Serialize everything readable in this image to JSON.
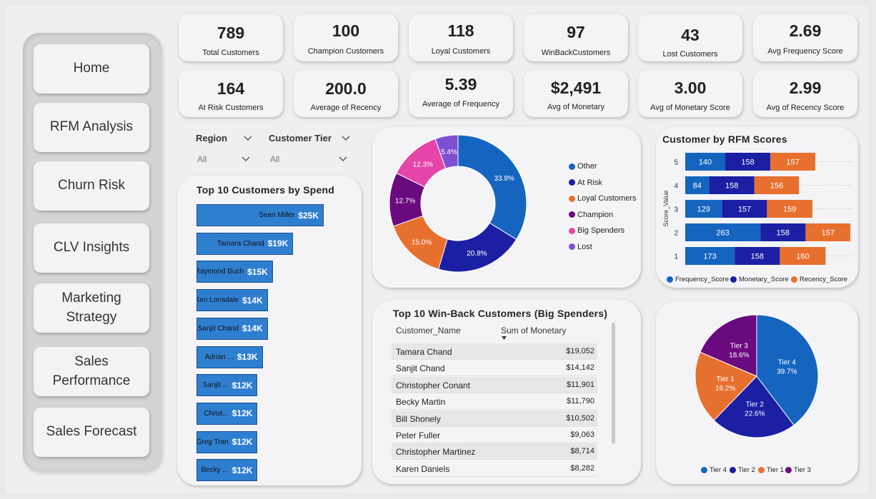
{
  "nav": {
    "home": "Home",
    "rfm": "RFM Analysis",
    "churn": "Churn Risk",
    "clv": "CLV Insights",
    "marketing_1": "Marketing",
    "marketing_2": "Strategy",
    "sales_perf_1": "Sales",
    "sales_perf_2": "Performance",
    "forecast": "Sales Forecast"
  },
  "kpis": [
    {
      "value": "789",
      "label": "Total Customers"
    },
    {
      "value": "100",
      "label": "Champion Customers"
    },
    {
      "value": "118",
      "label": "Loyal Customers"
    },
    {
      "value": "97",
      "label": "WinBackCustomers"
    },
    {
      "value": "43",
      "label": "Lost Customers"
    },
    {
      "value": "2.69",
      "label": "Avg Frequency Score"
    },
    {
      "value": "164",
      "label": "At Risk Customers"
    },
    {
      "value": "200.0",
      "label": "Average of Recency"
    },
    {
      "value": "5.39",
      "label": "Average of Frequency"
    },
    {
      "value": "$2,491",
      "label": "Avg of Monetary"
    },
    {
      "value": "3.00",
      "label": "Avg of Monetary Score"
    },
    {
      "value": "2.99",
      "label": "Avg of Recency Score"
    }
  ],
  "slicers": {
    "region_label": "Region",
    "region_value": "All",
    "tier_label": "Customer Tier",
    "tier_value": "All"
  },
  "top_spend": {
    "title": "Top 10 Customers by Spend",
    "rows": [
      {
        "name": "Sean Miller",
        "value": 25,
        "label": "$25K"
      },
      {
        "name": "Tamara Chand",
        "value": 19,
        "label": "$19K"
      },
      {
        "name": "Raymond Buch",
        "value": 15,
        "label": "$15K"
      },
      {
        "name": "Ken Lonsdale",
        "value": 14,
        "label": "$14K"
      },
      {
        "name": "Sanjit Chand",
        "value": 14,
        "label": "$14K"
      },
      {
        "name": "Adrian ...",
        "value": 13,
        "label": "$13K"
      },
      {
        "name": "Sanjit ...",
        "value": 12,
        "label": "$12K"
      },
      {
        "name": "Christ...",
        "value": 12,
        "label": "$12K"
      },
      {
        "name": "Greg Tran",
        "value": 12,
        "label": "$12K"
      },
      {
        "name": "Becky ...",
        "value": 12,
        "label": "$12K"
      }
    ]
  },
  "segments_donut": {
    "slices": [
      {
        "name": "Other",
        "value": 33.8,
        "label": "33.8%",
        "color": "#1565c0"
      },
      {
        "name": "At Risk",
        "value": 20.8,
        "label": "20.8%",
        "color": "#1a1fa3"
      },
      {
        "name": "Loyal Customers",
        "value": 15.0,
        "label": "15.0%",
        "color": "#e8702f"
      },
      {
        "name": "Champion",
        "value": 12.7,
        "label": "12.7%",
        "color": "#6b0a7e"
      },
      {
        "name": "Big Spenders",
        "value": 12.3,
        "label": "12.3%",
        "color": "#e545a9"
      },
      {
        "name": "Lost",
        "value": 5.4,
        "label": "5.4%",
        "color": "#7f4fd1"
      }
    ]
  },
  "rfm_scores": {
    "title": "Customer by RFM Scores",
    "ylabel": "Score_Value",
    "rows": [
      {
        "score": "5",
        "frequency": 140,
        "monetary": 158,
        "recency": 157
      },
      {
        "score": "4",
        "frequency": 84,
        "monetary": 158,
        "recency": 156
      },
      {
        "score": "3",
        "frequency": 129,
        "monetary": 157,
        "recency": 159
      },
      {
        "score": "2",
        "frequency": 263,
        "monetary": 158,
        "recency": 157
      },
      {
        "score": "1",
        "frequency": 173,
        "monetary": 158,
        "recency": 160
      }
    ],
    "legend": [
      {
        "name": "Frequency_Score",
        "color": "#1565c0"
      },
      {
        "name": "Monetary_Score",
        "color": "#1a1fa3"
      },
      {
        "name": "Recency_Score",
        "color": "#e8702f"
      }
    ]
  },
  "winback": {
    "title": "Top 10 Win-Back Customers (Big Spenders)",
    "col_name": "Customer_Name",
    "col_value": "Sum of Monetary",
    "rows": [
      {
        "name": "Tamara Chand",
        "value": "$19,052"
      },
      {
        "name": "Sanjit Chand",
        "value": "$14,142"
      },
      {
        "name": "Christopher Conant",
        "value": "$11,901"
      },
      {
        "name": "Becky Martin",
        "value": "$11,790"
      },
      {
        "name": "Bill Shonely",
        "value": "$10,502"
      },
      {
        "name": "Peter Fuller",
        "value": "$9,063"
      },
      {
        "name": "Christopher Martinez",
        "value": "$8,714"
      },
      {
        "name": "Karen Daniels",
        "value": "$8,282"
      }
    ]
  },
  "tier_pie": {
    "slices": [
      {
        "name": "Tier 4",
        "value": 39.7,
        "label": "39.7%",
        "color": "#1565c0"
      },
      {
        "name": "Tier 2",
        "value": 22.6,
        "label": "22.6%",
        "color": "#1a1fa3"
      },
      {
        "name": "Tier 1",
        "value": 19.2,
        "label": "19.2%",
        "color": "#e8702f"
      },
      {
        "name": "Tier 3",
        "value": 18.6,
        "label": "18.6%",
        "color": "#6b0a7e"
      }
    ]
  }
}
